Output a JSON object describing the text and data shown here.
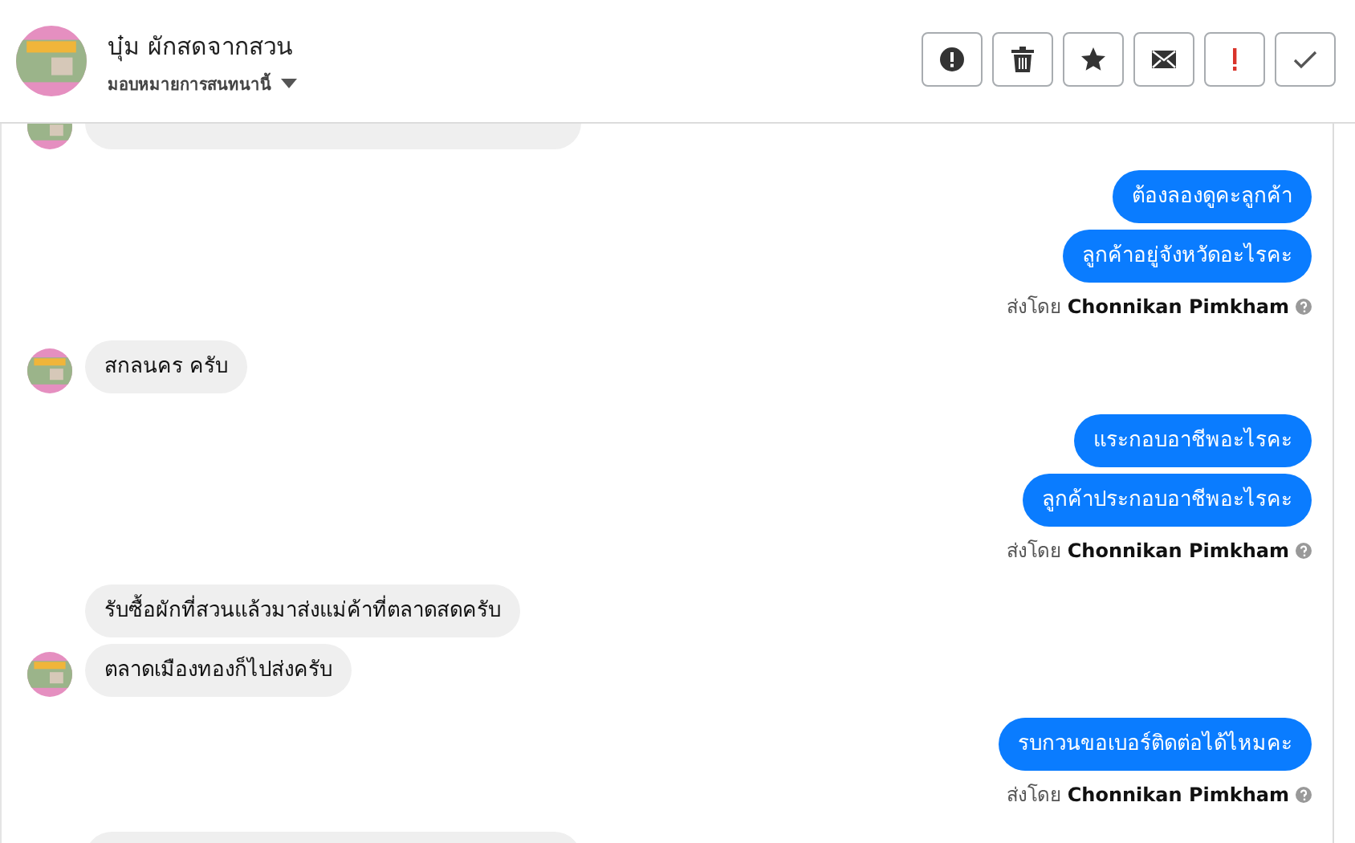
{
  "header": {
    "name": "บุ๋ม ผักสดจากสวน",
    "assign_label": "มอบหมายการสนทนานี้"
  },
  "actions": [
    {
      "kind": "alert"
    },
    {
      "kind": "trash"
    },
    {
      "kind": "star"
    },
    {
      "kind": "mail"
    },
    {
      "kind": "important"
    },
    {
      "kind": "done"
    }
  ],
  "groups": [
    {
      "kind": "clipped"
    },
    {
      "kind": "sent",
      "messages": [
        {
          "text": "ต้องลองดูคะลูกค้า"
        },
        {
          "text": "ลูกค้าอยู่จังหวัดอะไรคะ"
        }
      ],
      "sent_by_label": "ส่งโดย",
      "sender": "Chonnikan Pimkham"
    },
    {
      "kind": "received",
      "messages": [
        {
          "text": "สกลนคร ครับ"
        }
      ]
    },
    {
      "kind": "sent",
      "messages": [
        {
          "text": "แระกอบอาชีพอะไรคะ"
        },
        {
          "text": "ลูกค้าประกอบอาชีพอะไรคะ"
        }
      ],
      "sent_by_label": "ส่งโดย",
      "sender": "Chonnikan Pimkham"
    },
    {
      "kind": "received",
      "messages": [
        {
          "text": "รับซื้อผักที่สวนแล้วมาส่งแม่ค้าที่ตลาดสดครับ"
        },
        {
          "text": "ตลาดเมืองทองก็ไปส่งครับ"
        }
      ]
    },
    {
      "kind": "sent",
      "messages": [
        {
          "text": "รบกวนขอเบอร์ติดต่อได้ไหมคะ"
        }
      ],
      "sent_by_label": "ส่งโดย",
      "sender": "Chonnikan Pimkham"
    },
    {
      "kind": "clipped"
    }
  ]
}
